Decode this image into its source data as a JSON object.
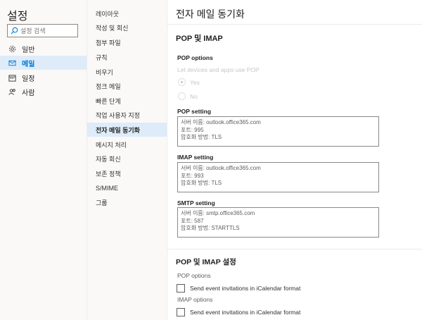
{
  "sidebar": {
    "title": "설정",
    "search_placeholder": "설정 검색",
    "items": [
      {
        "label": "일반",
        "icon": "gear-icon"
      },
      {
        "label": "메일",
        "icon": "mail-icon"
      },
      {
        "label": "일정",
        "icon": "calendar-icon"
      },
      {
        "label": "사람",
        "icon": "people-icon"
      }
    ]
  },
  "submenu": {
    "items": [
      {
        "label": "레이아웃"
      },
      {
        "label": "작성 및 회신"
      },
      {
        "label": "첨부 파일"
      },
      {
        "label": "규칙"
      },
      {
        "label": "비우기"
      },
      {
        "label": "정크 메일"
      },
      {
        "label": "빠른 단계"
      },
      {
        "label": "작업 사용자 지정"
      },
      {
        "label": "전자 메일 동기화"
      },
      {
        "label": "메시지 처리"
      },
      {
        "label": "자동 회신"
      },
      {
        "label": "보존 정책"
      },
      {
        "label": "S/MIME"
      },
      {
        "label": "그룹"
      }
    ]
  },
  "main": {
    "title": "전자 메일 동기화",
    "pop_imap_header": "POP 및 IMAP",
    "pop_options_label": "POP options",
    "let_devices_label": "Let devices and apps use POP",
    "radio_yes": "Yes",
    "radio_no": "No",
    "pop_setting": {
      "label": "POP setting",
      "server": "서버 이름: outlook.office365.com",
      "port": "포트: 995",
      "encryption": "암호화 방법: TLS"
    },
    "imap_setting": {
      "label": "IMAP setting",
      "server": "서버 이름: outlook.office365.com",
      "port": "포트: 993",
      "encryption": "암호화 방법: TLS"
    },
    "smtp_setting": {
      "label": "SMTP setting",
      "server": "서버 이름: smtp.office365.com",
      "port": "포트: 587",
      "encryption": "암호화 방법: STARTTLS"
    },
    "pop_imap_settings_header": "POP 및 IMAP 설정",
    "pop_options2_label": "POP options",
    "pop_send_invites": "Send event invitations in iCalendar format",
    "imap_options_label": "IMAP options",
    "imap_send_invites": "Send event invitations in iCalendar format"
  },
  "colors": {
    "accent": "#0078d4",
    "selected_bg": "#deecf9"
  }
}
